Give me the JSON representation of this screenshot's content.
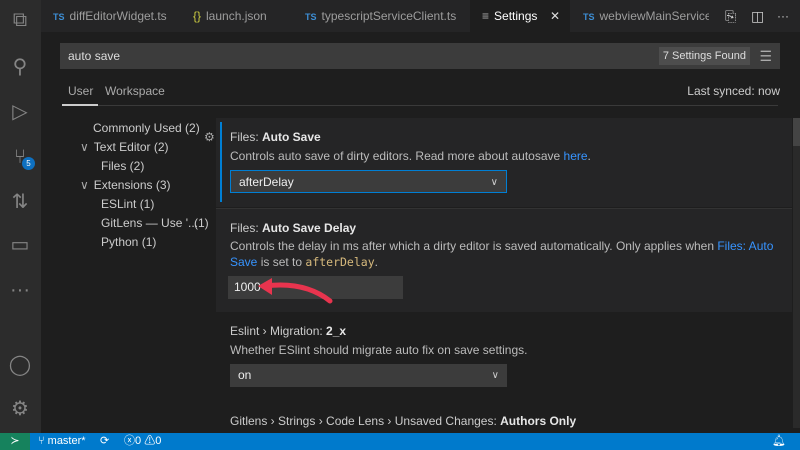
{
  "tabs": [
    {
      "label": "diffEditorWidget.ts",
      "type": "TS"
    },
    {
      "label": "launch.json",
      "type": "{}"
    },
    {
      "label": "typescriptServiceClient.ts",
      "type": "TS"
    },
    {
      "label": "Settings",
      "type": "settings",
      "active": true
    },
    {
      "label": "webviewMainService.ts",
      "type": "TS"
    }
  ],
  "search": {
    "value": "auto save",
    "results": "7 Settings Found"
  },
  "scope_tabs": {
    "user": "User",
    "workspace": "Workspace",
    "sync": "Last synced: now"
  },
  "toc": [
    "Commonly Used (2)",
    "Text Editor (2)",
    "Files (2)",
    "Extensions (3)",
    "ESLint (1)",
    "GitLens — Use '...",
    "(1)",
    "Python (1)"
  ],
  "settings": [
    {
      "category": "Files: ",
      "name": "Auto Save",
      "desc": "Controls auto save of dirty editors. Read more about autosave ",
      "link": "here",
      "after": ".",
      "value": "afterDelay"
    },
    {
      "category": "Files: ",
      "name": "Auto Save Delay",
      "desc": "Controls the delay in ms after which a dirty editor is saved automatically. Only applies when ",
      "link": "Files: Auto Save",
      "mid": " is set to ",
      "code": "afterDelay",
      "after": ".",
      "value": "1000"
    },
    {
      "category": "Eslint › Migration: ",
      "name": "2_x",
      "desc": "Whether ESlint should migrate auto fix on save settings.",
      "value": "on"
    },
    {
      "category": "Gitlens › Strings › Code Lens › Unsaved Changes: ",
      "name": "Authors Only"
    }
  ],
  "activity_badge": "5",
  "status": {
    "branch": "master*",
    "errors": "0",
    "warnings": "0"
  },
  "colors": {
    "accent": "#007acc",
    "annotation_arrow": "#e8344e"
  }
}
